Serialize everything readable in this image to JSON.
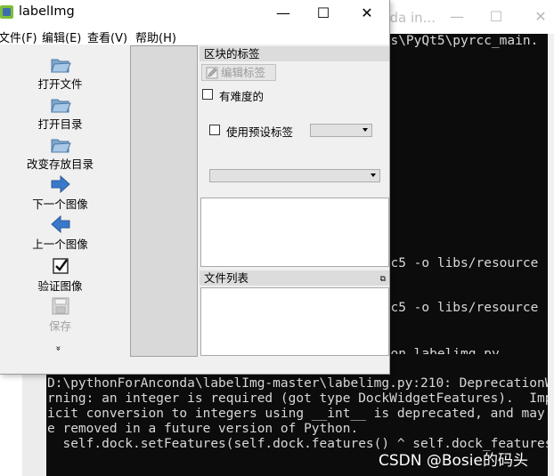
{
  "console": {
    "title": "nda  in...",
    "lines_right": [
      {
        "text": "ges\\PyQt5\\pyrcc_main."
      },
      {
        "text": "rcc5 -o libs/resource"
      },
      {
        "text": "rcc5 -o libs/resource"
      },
      {
        "text": "thon labelimg.py"
      },
      {
        "text": "l)"
      }
    ],
    "lines_bottom": [
      "D:\\pythonForAnconda\\labelImg-master\\labelimg.py:210: DeprecationWa",
      "rning: an integer is required (got type DockWidgetFeatures).  Impl",
      "icit conversion to integers using __int__ is deprecated, and may b",
      "e removed in a future version of Python.",
      "  self.dock.setFeatures(self.dock.features() ^ self.dock_features)"
    ],
    "watermark": "CSDN @Bosie的码头"
  },
  "app": {
    "title": "labelImg",
    "window_controls": {
      "minimize": "—",
      "maximize": "☐",
      "close": "✕"
    },
    "menu": [
      "文件(F)",
      "编辑(E)",
      "查看(V)",
      "帮助(H)"
    ],
    "tools": [
      {
        "label": "打开文件",
        "icon": "open-folder-icon",
        "enabled": true
      },
      {
        "label": "打开目录",
        "icon": "open-folder-icon",
        "enabled": true
      },
      {
        "label": "改变存放目录",
        "icon": "open-folder-icon",
        "enabled": true
      },
      {
        "label": "下一个图像",
        "icon": "arrow-right-icon",
        "enabled": true
      },
      {
        "label": "上一个图像",
        "icon": "arrow-left-icon",
        "enabled": true
      },
      {
        "label": "验证图像",
        "icon": "checkbox-icon",
        "enabled": true
      },
      {
        "label": "保存",
        "icon": "save-icon",
        "enabled": false
      }
    ],
    "more_indicator": "»",
    "dock": {
      "label_panel_title": "区块的标签",
      "edit_label_button": "编辑标签",
      "difficult_checkbox": "有难度的",
      "use_default_label_checkbox": "使用预设标签",
      "file_list_title": "文件列表",
      "float_button": "⧉"
    }
  }
}
